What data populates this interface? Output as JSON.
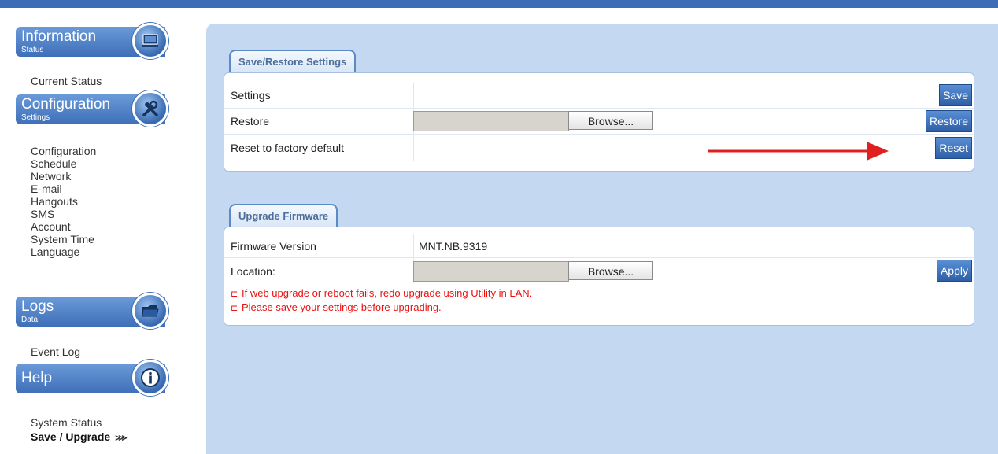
{
  "sidebar": {
    "information": {
      "title": "Information",
      "subtitle": "Status",
      "items": [
        "Current Status"
      ]
    },
    "configuration": {
      "title": "Configuration",
      "subtitle": "Settings",
      "items": [
        "Configuration",
        "Schedule",
        "Network",
        "E-mail",
        "Hangouts",
        "SMS",
        "Account",
        "System Time",
        "Language"
      ]
    },
    "logs": {
      "title": "Logs",
      "subtitle": "Data",
      "items": [
        "Event Log"
      ]
    },
    "help": {
      "title": "Help",
      "items": [
        "System Status",
        "Save / Upgrade"
      ],
      "active_marker": "⋙"
    }
  },
  "save_restore": {
    "tab_label": "Save/Restore Settings",
    "rows": {
      "settings": {
        "label": "Settings",
        "button": "Save"
      },
      "restore": {
        "label": "Restore",
        "browse": "Browse...",
        "button": "Restore",
        "file_value": ""
      },
      "reset": {
        "label": "Reset to factory default",
        "button": "Reset"
      }
    }
  },
  "upgrade_firmware": {
    "tab_label": "Upgrade Firmware",
    "rows": {
      "version": {
        "label": "Firmware Version",
        "value": "MNT.NB.9319"
      },
      "location": {
        "label": "Location:",
        "browse": "Browse...",
        "button": "Apply",
        "file_value": ""
      }
    },
    "warnings": [
      "If web upgrade or reboot fails, redo upgrade using Utility in LAN.",
      "Please save your settings before upgrading."
    ],
    "warning_icon": "⊏"
  },
  "colors": {
    "accent": "#3e6fb8",
    "panel": "#c4d8f2",
    "warning": "#e11111",
    "arrow": "#e02020"
  },
  "icons": {
    "information": "monitor-icon",
    "configuration": "tools-icon",
    "logs": "folder-icon",
    "help": "info-icon",
    "annotation": "red-arrow"
  }
}
